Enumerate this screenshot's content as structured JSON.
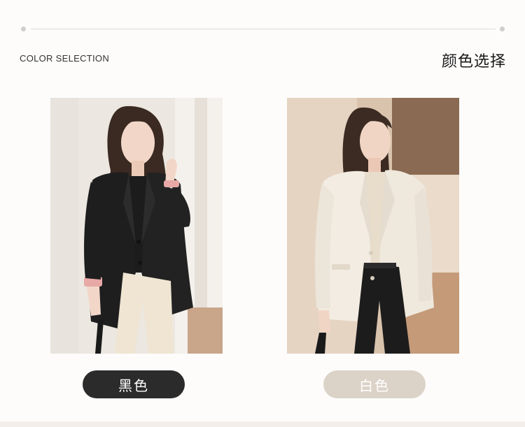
{
  "section": {
    "title_en": "COLOR SELECTION",
    "title_zh": "颜色选择"
  },
  "colors": [
    {
      "label": "黑色",
      "swatch_color": "#2b2b2b"
    },
    {
      "label": "白色",
      "swatch_color": "#dcd3c8"
    }
  ]
}
